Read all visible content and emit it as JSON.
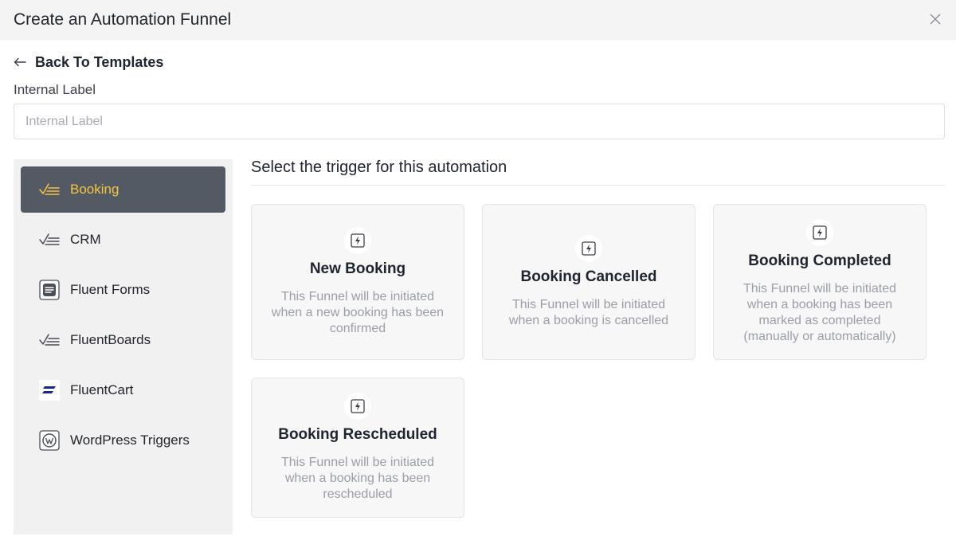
{
  "header": {
    "title": "Create an Automation Funnel"
  },
  "back_link": {
    "label": "Back To Templates"
  },
  "internal_label": {
    "label": "Internal Label",
    "placeholder": "Internal Label",
    "value": ""
  },
  "sidebar": {
    "items": [
      {
        "label": "Booking",
        "icon": "checklist-icon",
        "active": true
      },
      {
        "label": "CRM",
        "icon": "checklist-icon",
        "active": false
      },
      {
        "label": "Fluent Forms",
        "icon": "fluent-forms-icon",
        "active": false
      },
      {
        "label": "FluentBoards",
        "icon": "checklist-icon",
        "active": false
      },
      {
        "label": "FluentCart",
        "icon": "fluentcart-icon",
        "active": false
      },
      {
        "label": "WordPress Triggers",
        "icon": "wordpress-icon",
        "active": false
      }
    ]
  },
  "main": {
    "heading": "Select the trigger for this automation",
    "triggers": [
      {
        "title": "New Booking",
        "description": "This Funnel will be initiated when a new booking has been confirmed",
        "icon": "lightning-icon"
      },
      {
        "title": "Booking Cancelled",
        "description": "This Funnel will be initiated when a booking is cancelled",
        "icon": "lightning-icon"
      },
      {
        "title": "Booking Completed",
        "description": "This Funnel will be initiated when a booking has been marked as completed (manually or automatically)",
        "icon": "lightning-icon"
      },
      {
        "title": "Booking Rescheduled",
        "description": "This Funnel will be initiated when a booking has been rescheduled",
        "icon": "lightning-icon"
      }
    ]
  },
  "colors": {
    "active_bg": "#535a63",
    "active_text": "#f5c542",
    "header_bg": "#f4f4f5",
    "card_bg": "#f7f7f8"
  }
}
